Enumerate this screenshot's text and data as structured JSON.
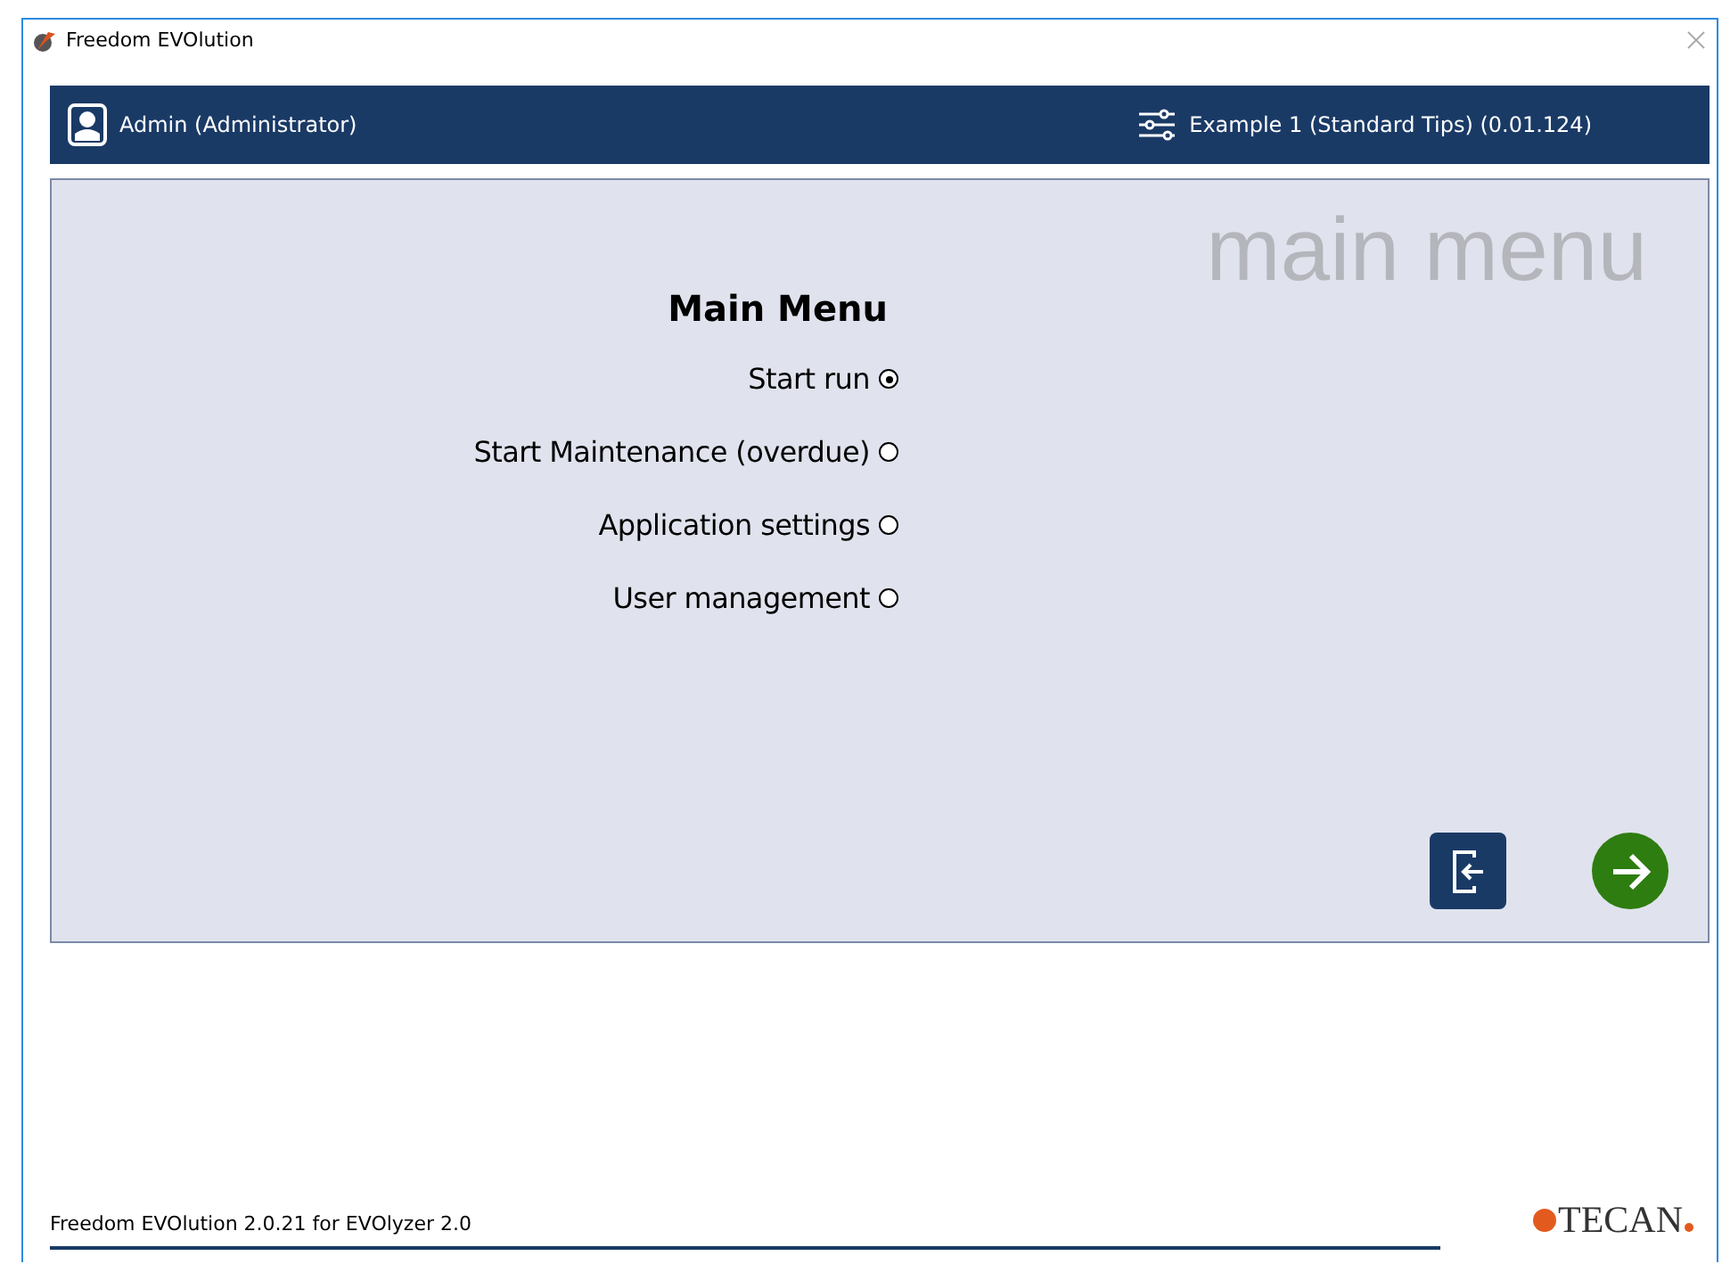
{
  "window": {
    "title": "Freedom EVOlution"
  },
  "header": {
    "user": "Admin (Administrator)",
    "method": "Example 1 (Standard Tips) (0.01.124)"
  },
  "panel": {
    "background_title": "main menu",
    "title": "Main Menu",
    "options": [
      {
        "label": "Start run",
        "selected": true
      },
      {
        "label": "Start Maintenance (overdue)",
        "selected": false
      },
      {
        "label": "Application settings",
        "selected": false
      },
      {
        "label": "User management",
        "selected": false
      }
    ]
  },
  "footer": {
    "version": "Freedom EVOlution 2.0.21 for EVOlyzer 2.0",
    "logo": "TECAN"
  }
}
